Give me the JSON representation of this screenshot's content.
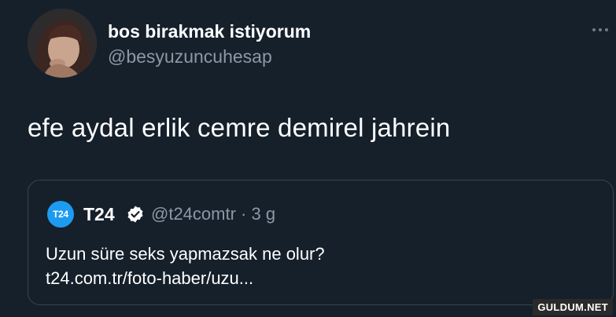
{
  "tweet": {
    "author_name": "bos birakmak istiyorum",
    "author_handle": "@besyuzuncuhesap",
    "text": "efe aydal erlik cemre demirel jahrein",
    "menu_icon": "more-horizontal-icon"
  },
  "quote": {
    "logo_text": "T24",
    "name": "T24",
    "verified_icon": "verified-badge-icon",
    "handle": "@t24comtr",
    "separator": "·",
    "age": "3 g",
    "text_line1": "Uzun süre seks yapmazsak ne olur?",
    "text_line2": "t24.com.tr/foto-haber/uzu..."
  },
  "watermark": "GULDUM.NET",
  "colors": {
    "background": "#15202b",
    "text": "#ffffff",
    "muted": "#8b98a5",
    "border": "#38444d",
    "accent": "#1d9bf0"
  }
}
